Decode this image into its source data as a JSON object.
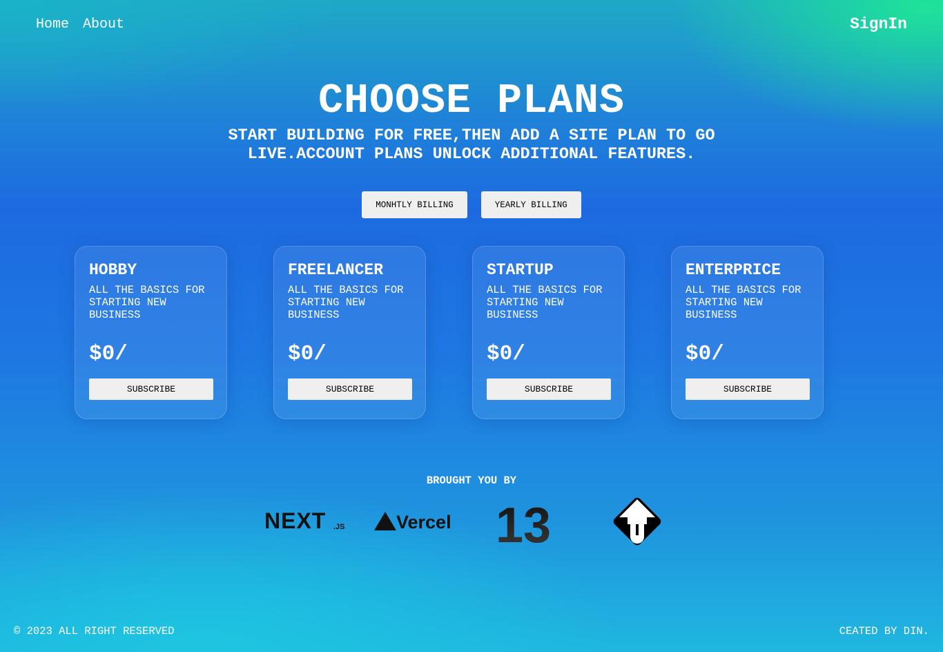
{
  "nav": {
    "home": "Home",
    "about": "About",
    "signin": "SignIn"
  },
  "hero": {
    "title": "CHOOSE PLANS",
    "subtitle": "START BUILDING FOR FREE,THEN ADD A SITE PLAN TO GO LIVE.ACCOUNT PLANS UNLOCK ADDITIONAL FEATURES."
  },
  "billing": {
    "monthly": "MONHTLY BILLING",
    "yearly": "YEARLY BILLING"
  },
  "plans": [
    {
      "name": "HOBBY",
      "desc": "ALL THE BASICS FOR STARTING NEW BUSINESS",
      "price": "$0/",
      "button": "SUBSCRIBE"
    },
    {
      "name": "FREELANCER",
      "desc": "ALL THE BASICS FOR STARTING NEW BUSINESS",
      "price": "$0/",
      "button": "SUBSCRIBE"
    },
    {
      "name": "STARTUP",
      "desc": "ALL THE BASICS FOR STARTING NEW BUSINESS",
      "price": "$0/",
      "button": "SUBSCRIBE"
    },
    {
      "name": "ENTERPRICE",
      "desc": "ALL THE BASICS FOR STARTING NEW BUSINESS",
      "price": "$0/",
      "button": "SUBSCRIBE"
    }
  ],
  "sponsors": {
    "heading": "BROUGHT YOU BY",
    "logos": [
      {
        "icon": "nextjs-logo",
        "text": "NEXT.JS"
      },
      {
        "icon": "vercel-logo",
        "text": "Vercel"
      },
      {
        "icon": "version-13-logo",
        "text": "13"
      },
      {
        "icon": "turborepo-diamond-logo",
        "text": ""
      }
    ]
  },
  "footer": {
    "copyright": "© 2023 ALL RIGHT RESERVED",
    "credit": "CEATED BY DIN."
  },
  "colors": {
    "card_button": "#efefef",
    "text": "#ffffff",
    "accent_green": "#1ee696",
    "accent_blue": "#1d6ae0"
  }
}
